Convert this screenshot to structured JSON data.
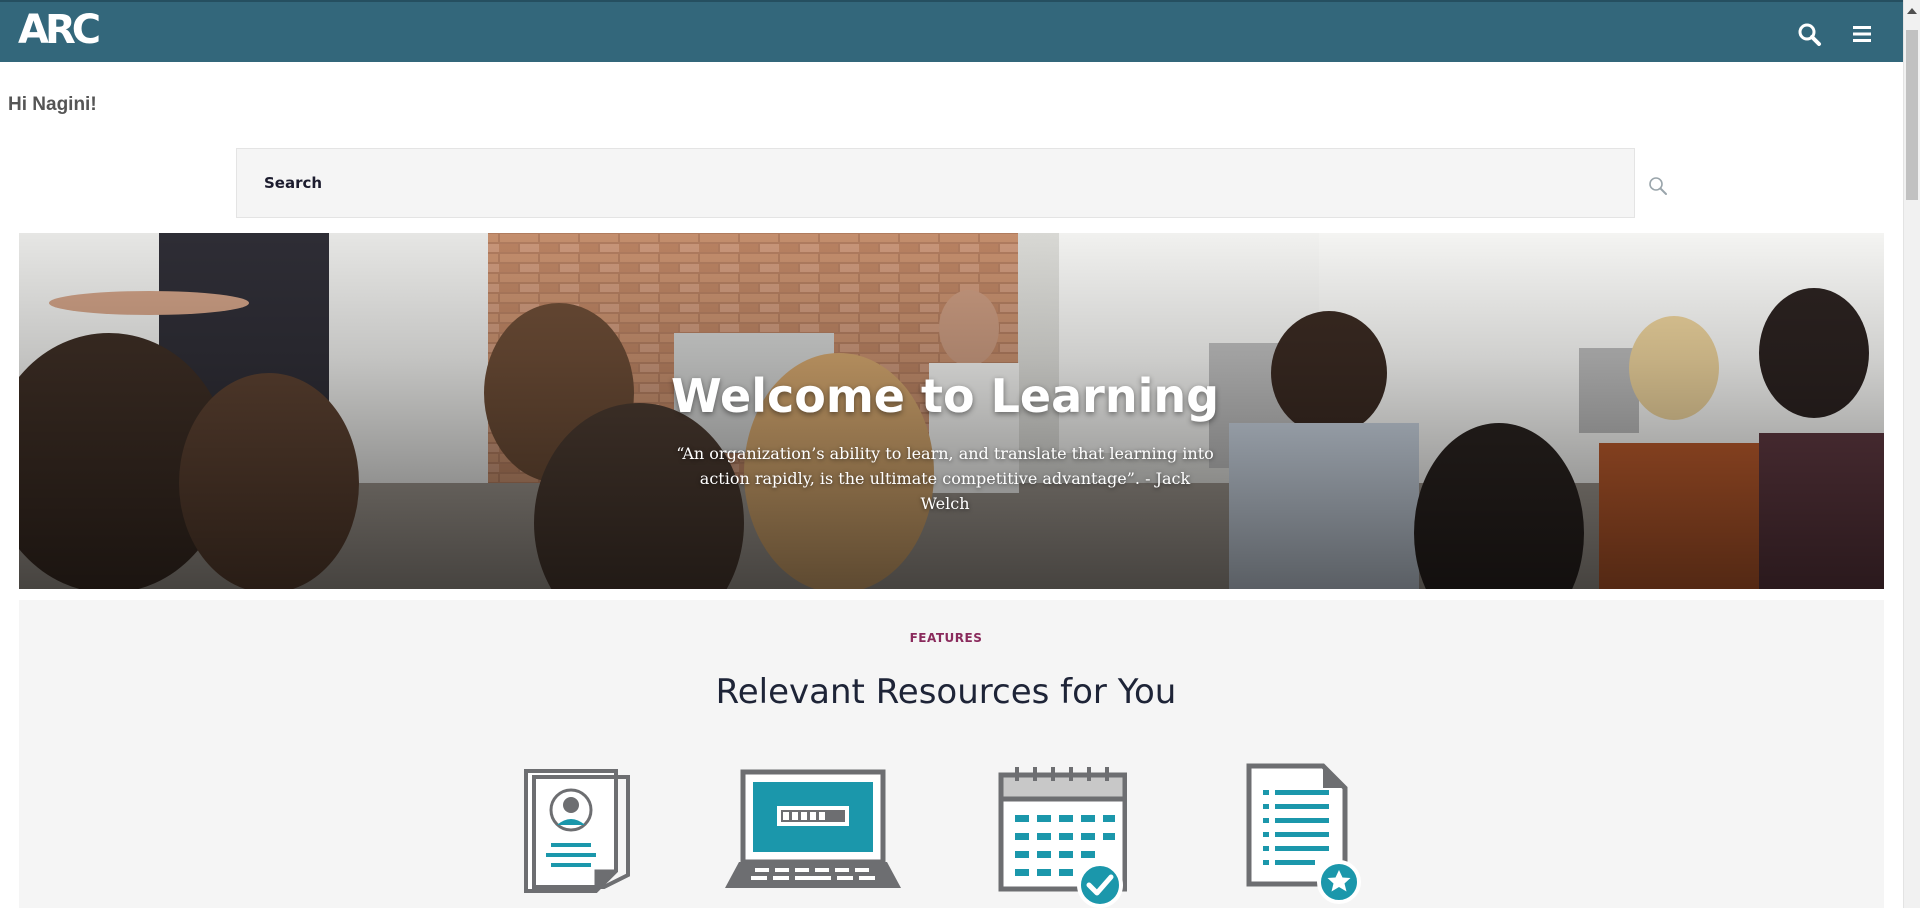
{
  "header": {
    "logo_text": "ARC",
    "search_icon": "search-icon",
    "menu_icon": "hamburger-menu-icon",
    "background_color": "#33677b"
  },
  "greeting": {
    "text": "Hi Nagini!"
  },
  "search": {
    "placeholder": "Search",
    "submit_icon": "magnifier-icon"
  },
  "hero": {
    "title": "Welcome to Learning",
    "quote": "“An organization’s ability to learn, and translate that learning into action rapidly, is the ultimate competitive advantage”. - Jack Welch"
  },
  "features": {
    "eyebrow": "FEATURES",
    "title": "Relevant Resources for You",
    "icons": [
      "profile-document-icon",
      "laptop-icon",
      "calendar-check-icon",
      "list-document-star-icon"
    ],
    "accent_color": "#1b97ab",
    "eyebrow_color": "#8a2a5c"
  },
  "colors": {
    "icon_gray": "#6d6e71",
    "page_bg": "#ffffff",
    "section_bg": "#f5f5f5"
  }
}
